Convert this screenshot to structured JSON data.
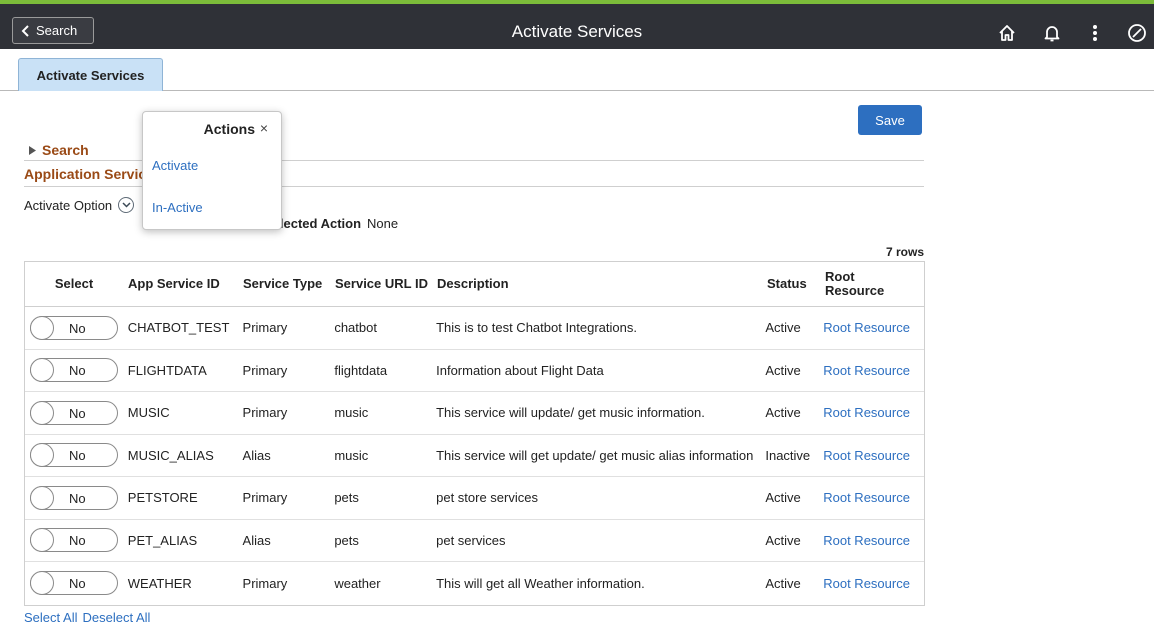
{
  "header": {
    "back_label": "Search",
    "title": "Activate Services",
    "icons": [
      "home-icon",
      "bell-icon",
      "more-vertical-icon",
      "navbar-compass-icon"
    ]
  },
  "tabs": [
    {
      "label": "Activate Services",
      "active": true
    }
  ],
  "toolbar": {
    "save_label": "Save"
  },
  "search_section": {
    "label": "Search"
  },
  "section_title": "Application Services",
  "activate_option": {
    "label": "Activate Option",
    "selected_action_label": "Selected Action",
    "selected_action_value": "None"
  },
  "rows_count": "7 rows",
  "table": {
    "columns": [
      "Select",
      "App Service ID",
      "Service Type",
      "Service URL ID",
      "Description",
      "Status",
      "Root Resource"
    ],
    "rows": [
      {
        "select": "No",
        "app_service_id": "CHATBOT_TEST",
        "service_type": "Primary",
        "service_url_id": "chatbot",
        "description": "This is to test Chatbot Integrations.",
        "status": "Active",
        "root_resource": "Root Resource"
      },
      {
        "select": "No",
        "app_service_id": "FLIGHTDATA",
        "service_type": "Primary",
        "service_url_id": "flightdata",
        "description": "Information about Flight Data",
        "status": "Active",
        "root_resource": "Root Resource"
      },
      {
        "select": "No",
        "app_service_id": "MUSIC",
        "service_type": "Primary",
        "service_url_id": "music",
        "description": "This service will update/ get music information.",
        "status": "Active",
        "root_resource": "Root Resource"
      },
      {
        "select": "No",
        "app_service_id": "MUSIC_ALIAS",
        "service_type": "Alias",
        "service_url_id": "music",
        "description": "This service will get update/ get music alias information",
        "status": "Inactive",
        "root_resource": "Root Resource"
      },
      {
        "select": "No",
        "app_service_id": "PETSTORE",
        "service_type": "Primary",
        "service_url_id": "pets",
        "description": "pet store services",
        "status": "Active",
        "root_resource": "Root Resource"
      },
      {
        "select": "No",
        "app_service_id": "PET_ALIAS",
        "service_type": "Alias",
        "service_url_id": "pets",
        "description": "pet services",
        "status": "Active",
        "root_resource": "Root Resource"
      },
      {
        "select": "No",
        "app_service_id": "WEATHER",
        "service_type": "Primary",
        "service_url_id": "weather",
        "description": "This will get all Weather information.",
        "status": "Active",
        "root_resource": "Root Resource"
      }
    ]
  },
  "footer_links": {
    "select_all": "Select All",
    "deselect_all": "Deselect All"
  },
  "actions_popup": {
    "title": "Actions",
    "close": "×",
    "items": [
      "Activate",
      "In-Active"
    ]
  },
  "colors": {
    "header_bg": "#2f3137",
    "header_accent": "#7cbc3a",
    "link": "#2d6fc0",
    "section_title": "#9a4a16",
    "tab_active": "#c9e1f6",
    "save_button": "#2d6fc0"
  }
}
